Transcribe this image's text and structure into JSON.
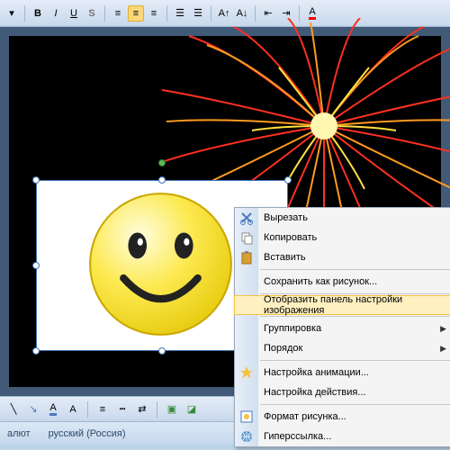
{
  "toolbar": {
    "hint": "Formatting toolbar"
  },
  "context_menu": {
    "cut": "Вырезать",
    "copy": "Копировать",
    "paste": "Вставить",
    "save_as_picture": "Сохранить как рисунок...",
    "show_picture_toolbar": "Отобразить панель настройки изображения",
    "grouping": "Группировка",
    "order": "Порядок",
    "custom_animation": "Настройка анимации...",
    "action_settings": "Настройка действия...",
    "format_picture": "Формат рисунка...",
    "hyperlink": "Гиперссылка..."
  },
  "status": {
    "left": "алют",
    "language": "русский (Россия)"
  },
  "colors": {
    "highlight_bg": "#fff0c1",
    "highlight_border": "#f5c242",
    "menu_bg": "#f4f4f4"
  }
}
